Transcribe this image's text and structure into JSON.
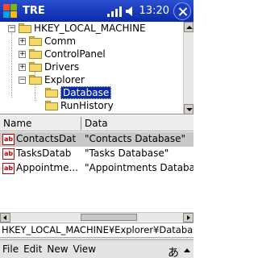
{
  "titlebar": {
    "app_title": "TRE",
    "clock": "13:20",
    "ok_label": "ok"
  },
  "tree": {
    "items": [
      {
        "label": "HKEY_LOCAL_MACHINE",
        "expander": "−"
      },
      {
        "label": "Comm",
        "expander": "+"
      },
      {
        "label": "ControlPanel",
        "expander": "+"
      },
      {
        "label": "Drivers",
        "expander": "+"
      },
      {
        "label": "Explorer",
        "expander": "−"
      },
      {
        "label": "Database",
        "expander": ""
      },
      {
        "label": "RunHistory",
        "expander": ""
      }
    ]
  },
  "list": {
    "columns": [
      "Name",
      "Data"
    ],
    "rows": [
      {
        "icon": "ab",
        "name": "ContactsDat",
        "data": "\"Contacts Database\""
      },
      {
        "icon": "ab",
        "name": "TasksDatab",
        "data": "\"Tasks Database\""
      },
      {
        "icon": "ab",
        "name": "Appointme...",
        "data": "\"Appointments Databa"
      }
    ]
  },
  "path": "HKEY_LOCAL_MACHINE¥Explorer¥Database",
  "menubar": {
    "items": [
      "File",
      "Edit",
      "New",
      "View"
    ],
    "ime_glyph": "あ"
  },
  "toolbar_icons": [
    "cut-icon",
    "copy-icon",
    "paste-icon",
    "delete-icon",
    "refresh-icon",
    "search-icon"
  ]
}
